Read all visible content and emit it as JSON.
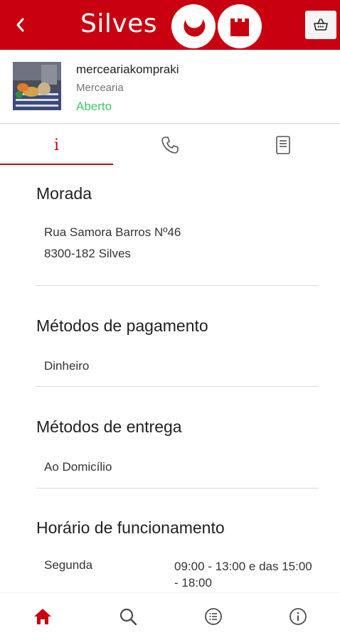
{
  "header": {
    "title": "Silves",
    "back_icon": "chevron-left-icon",
    "basket_icon": "basket-icon",
    "brand_color": "#c8000f"
  },
  "store": {
    "name": "merceariakompraki",
    "category": "Mercearia",
    "status": "Aberto",
    "status_color": "#3fc76a"
  },
  "tabs": [
    {
      "label": "i",
      "icon": "info-icon",
      "active": true
    },
    {
      "label": "",
      "icon": "phone-icon",
      "active": false
    },
    {
      "label": "",
      "icon": "menu-document-icon",
      "active": false
    }
  ],
  "details": {
    "address_title": "Morada",
    "address_line1": "Rua Samora Barros Nº46",
    "address_line2": "8300-182 Silves",
    "payment_title": "Métodos de pagamento",
    "payment_method": "Dinheiro",
    "delivery_title": "Métodos de entrega",
    "delivery_method": "Ao Domicílio",
    "hours_title": "Horário de funcionamento",
    "hours": [
      {
        "day": "Segunda",
        "time": "09:00 - 13:00 e das 15:00 - 18:00"
      }
    ]
  },
  "bottom_nav": [
    {
      "icon": "home-icon",
      "active": true
    },
    {
      "icon": "search-icon",
      "active": false
    },
    {
      "icon": "list-icon",
      "active": false
    },
    {
      "icon": "info-icon",
      "active": false
    }
  ]
}
